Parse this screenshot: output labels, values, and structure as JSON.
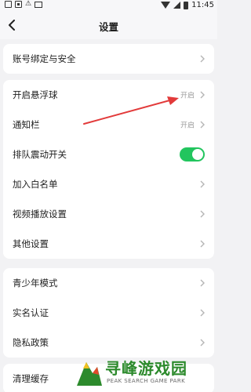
{
  "status_bar": {
    "time": "11:45"
  },
  "header": {
    "title": "设置"
  },
  "group_account": [
    {
      "label": "账号绑定与安全"
    }
  ],
  "group_features": [
    {
      "label": "开启悬浮球",
      "value": "开启"
    },
    {
      "label": "通知栏",
      "value": "开启"
    },
    {
      "label": "排队震动开关",
      "toggle_on": true
    },
    {
      "label": "加入白名单"
    },
    {
      "label": "视频播放设置"
    },
    {
      "label": "其他设置"
    }
  ],
  "group_privacy": [
    {
      "label": "青少年模式"
    },
    {
      "label": "实名认证"
    },
    {
      "label": "隐私政策"
    }
  ],
  "group_cache": [
    {
      "label": "清理缓存"
    }
  ],
  "watermark": {
    "title": "寻峰游戏园",
    "subtitle": "PEAK SEARCH GAME PARK"
  },
  "colors": {
    "toggle_on": "#22c55e",
    "annotation_arrow": "#e23a3a",
    "watermark_green": "#2c8a2c"
  }
}
